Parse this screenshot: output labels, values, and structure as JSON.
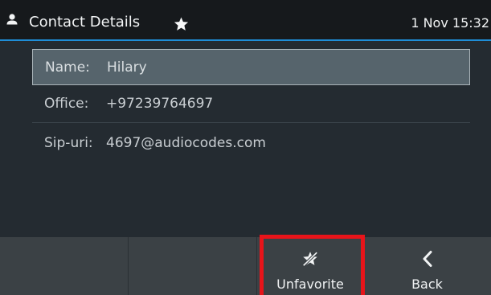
{
  "header": {
    "user_icon": "person-icon",
    "title": "Contact Details",
    "favorite_icon": "star-icon",
    "datetime": "1 Nov 15:32",
    "accent_color": "#1f8ed8"
  },
  "details": {
    "rows": [
      {
        "label": "Name:",
        "value": "Hilary",
        "selected": true
      },
      {
        "label": "Office:",
        "value": "+97239764697",
        "selected": false
      },
      {
        "label": "Sip-uri:",
        "value": "4697@audiocodes.com",
        "selected": false
      }
    ]
  },
  "softkeys": [
    {
      "label": "",
      "icon": ""
    },
    {
      "label": "",
      "icon": ""
    },
    {
      "label": "Unfavorite",
      "icon": "star-slash-icon",
      "highlighted": true,
      "highlight_color": "#e8141a"
    },
    {
      "label": "Back",
      "icon": "chevron-left-icon"
    }
  ]
}
